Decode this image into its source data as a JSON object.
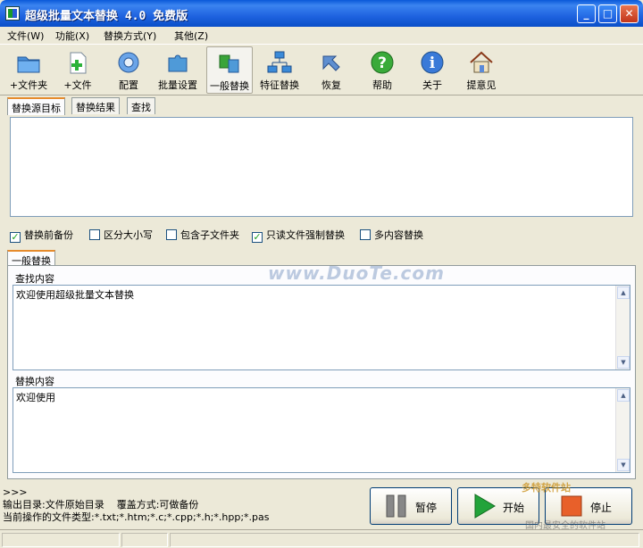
{
  "window": {
    "title": "超级批量文本替换 4.0 免费版",
    "minimize": "_",
    "maximize": "□",
    "close": "✕"
  },
  "menu": [
    "文件(W)",
    "功能(X)",
    "替换方式(Y)",
    "其他(Z)"
  ],
  "toolbar": {
    "add_folder": "+文件夹",
    "add_file": "+文件",
    "config": "配置",
    "batch_settings": "批量设置",
    "general_replace": "一般替换",
    "feature_replace": "特征替换",
    "restore": "恢复",
    "help": "帮助",
    "about": "关于",
    "feedback": "提意见",
    "active": "general_replace"
  },
  "top_tabs": [
    "替换源目标",
    "替换结果",
    "查找"
  ],
  "options": [
    {
      "label": "替换前备份",
      "checked": true
    },
    {
      "label": "区分大小写",
      "checked": false
    },
    {
      "label": "包含子文件夹",
      "checked": false
    },
    {
      "label": "只读文件强制替换",
      "checked": true
    },
    {
      "label": "多内容替换",
      "checked": false
    }
  ],
  "mode_tab": "一般替换",
  "watermark": "www.DuoTe.com",
  "find": {
    "label": "查找内容",
    "value": "欢迎使用超级批量文本替换"
  },
  "replace": {
    "label": "替换内容",
    "value": "欢迎使用"
  },
  "status": {
    "line1": ">>>",
    "line2": "输出目录:文件原始目录    覆盖方式:可做备份",
    "line3": "当前操作的文件类型:*.txt;*.htm;*.c;*.cpp;*.h;*.hpp;*.pas"
  },
  "actions": {
    "pause": "暂停",
    "start": "开始",
    "stop": "停止"
  },
  "corner": {
    "logo": "多特软件站",
    "caption": "国内最安全的软件站"
  },
  "colors": {
    "title_blue": "#1f63e0",
    "start_green": "#22a33a",
    "stop_orange": "#e8602a",
    "tab_accent": "#e68b2c"
  }
}
